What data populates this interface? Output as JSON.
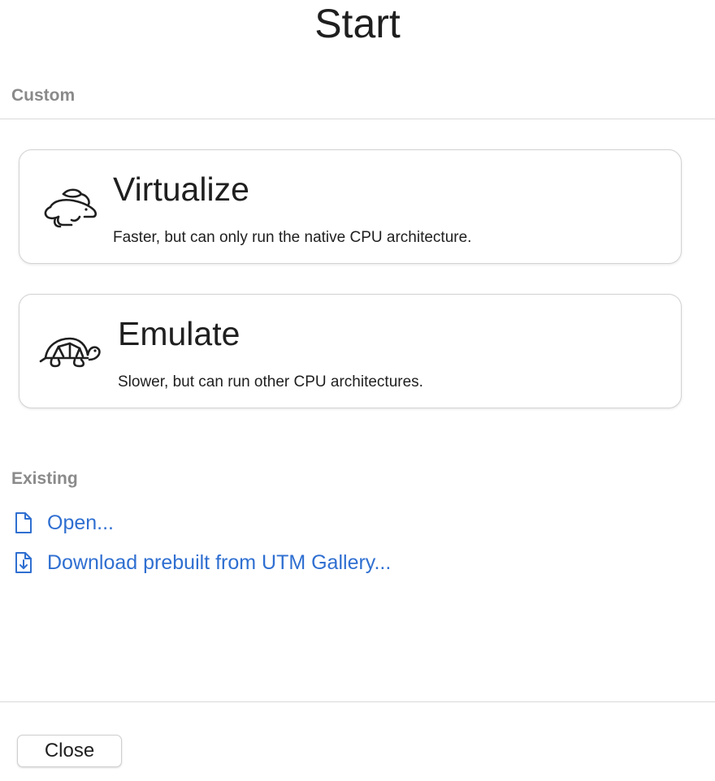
{
  "window": {
    "title": "Start"
  },
  "custom": {
    "section_label": "Custom",
    "options": [
      {
        "title": "Virtualize",
        "description": "Faster, but can only run the native CPU architecture.",
        "icon": "hare-icon"
      },
      {
        "title": "Emulate",
        "description": "Slower, but can run other CPU architectures.",
        "icon": "tortoise-icon"
      }
    ]
  },
  "existing": {
    "section_label": "Existing",
    "links": [
      {
        "label": "Open...",
        "icon": "document-icon"
      },
      {
        "label": "Download prebuilt from UTM Gallery...",
        "icon": "document-download-icon"
      }
    ]
  },
  "footer": {
    "close_label": "Close"
  },
  "colors": {
    "link": "#2f6fd1",
    "section_label": "#8a8a8a",
    "divider": "#d9d9d9"
  }
}
